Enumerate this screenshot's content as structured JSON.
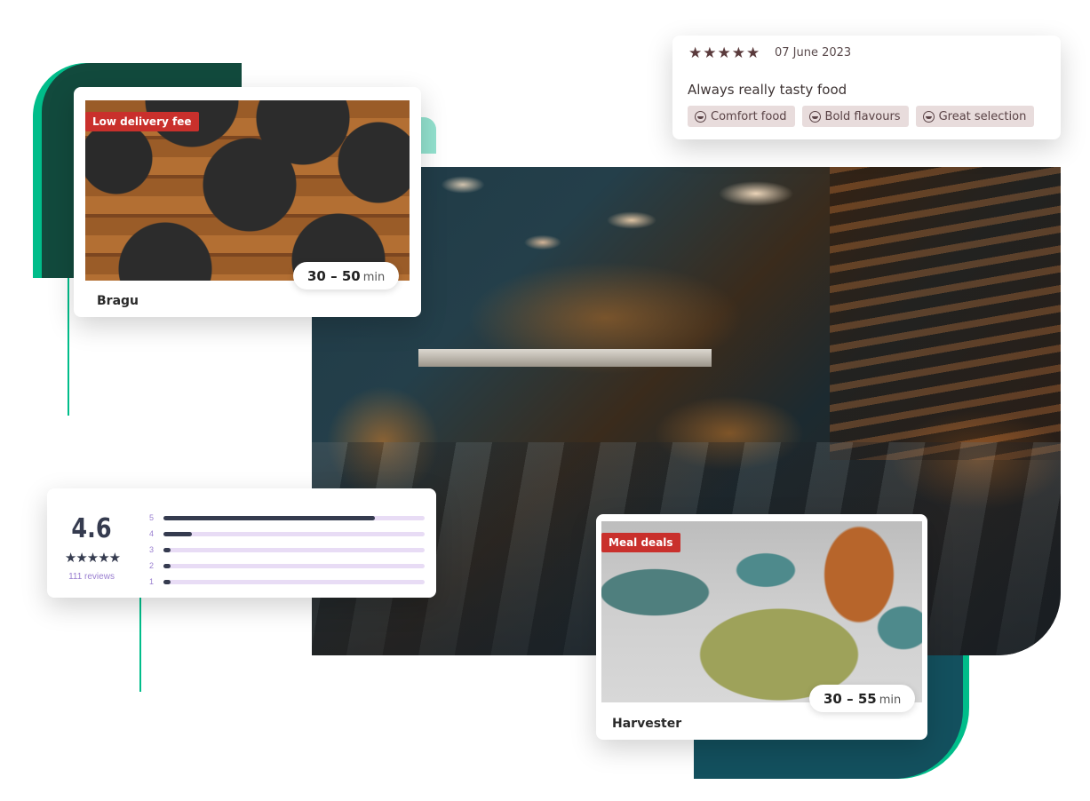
{
  "review": {
    "stars": "★★★★★",
    "rating": 5,
    "date": "07 June 2023",
    "text": "Always really tasty food",
    "tags": [
      {
        "icon": "smiley-icon",
        "label": "Comfort food"
      },
      {
        "icon": "smiley-icon",
        "label": "Bold flavours"
      },
      {
        "icon": "smiley-icon",
        "label": "Great selection"
      }
    ]
  },
  "restaurants": [
    {
      "name": "Bragu",
      "badge": "Low delivery fee",
      "eta_range": "30 – 50",
      "eta_unit": "min"
    },
    {
      "name": "Harvester",
      "badge": "Meal deals",
      "eta_range": "30 – 55",
      "eta_unit": "min"
    }
  ],
  "rating_summary": {
    "score": "4.6",
    "stars": "★★★★★",
    "reviews_label": "111 reviews",
    "distribution": [
      {
        "stars": "5",
        "fraction": 0.81
      },
      {
        "stars": "4",
        "fraction": 0.11
      },
      {
        "stars": "3",
        "fraction": 0.02
      },
      {
        "stars": "2",
        "fraction": 0.02
      },
      {
        "stars": "1",
        "fraction": 0.02
      }
    ]
  },
  "colors": {
    "accent_green": "#00bd8a",
    "dark_green": "#124a3d",
    "dark_teal": "#13505e",
    "badge_red": "#c9302c",
    "tag_bg": "#e8dcdc",
    "rating_dark": "#353b4f",
    "rating_purple": "#9a7fd0"
  }
}
